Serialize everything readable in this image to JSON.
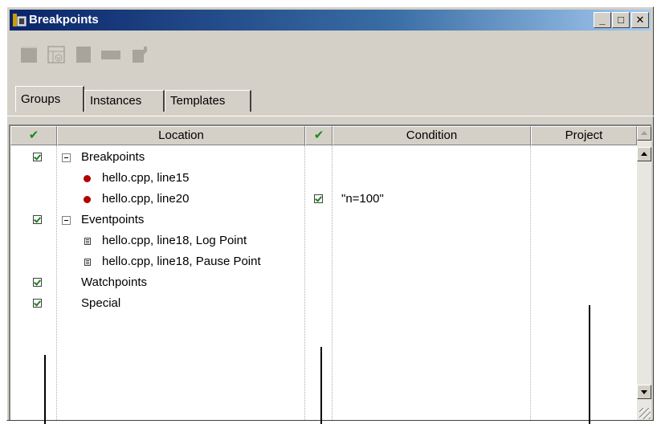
{
  "window": {
    "title": "Breakpoints"
  },
  "caption_buttons": {
    "minimize": "_",
    "maximize": "□",
    "close": "✕"
  },
  "toolbar": {
    "icons": [
      "new-breakpoint-icon",
      "new-group-icon",
      "remove-icon",
      "disable-icon",
      "edit-icon"
    ]
  },
  "tabs": [
    "Groups",
    "Instances",
    "Templates"
  ],
  "columns": {
    "enabled": "✔",
    "location": "Location",
    "cond_enabled": "✔",
    "condition": "Condition",
    "project": "Project"
  },
  "rows": [
    {
      "label": "Breakpoints",
      "checked": true,
      "expander": "minus"
    },
    {
      "label": "hello.cpp, line15",
      "icon": "breakpoint-dot"
    },
    {
      "label": "hello.cpp, line20",
      "icon": "breakpoint-dot",
      "condition_checked": true,
      "condition": "\"n=100\""
    },
    {
      "label": "Eventpoints",
      "checked": true,
      "expander": "minus"
    },
    {
      "label": "hello.cpp, line18, Log Point",
      "icon": "log-point-icon"
    },
    {
      "label": "hello.cpp, line18, Pause Point",
      "icon": "log-point-icon"
    },
    {
      "label": "Watchpoints",
      "checked": true
    },
    {
      "label": "Special",
      "checked": true
    }
  ],
  "colors": {
    "title_bar": "#0a246a",
    "face": "#d4d0c8",
    "breakpoint": "#b00000",
    "check": "#208020"
  }
}
